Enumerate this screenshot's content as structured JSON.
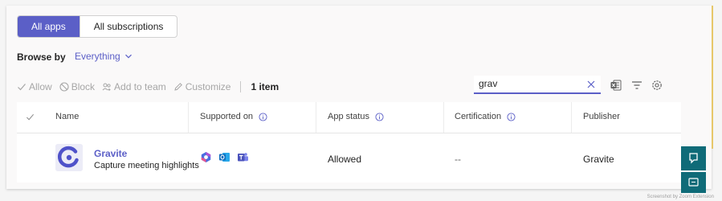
{
  "tabs": [
    {
      "label": "All apps",
      "active": true
    },
    {
      "label": "All subscriptions",
      "active": false
    }
  ],
  "browse": {
    "label": "Browse by",
    "value": "Everything"
  },
  "toolbar": {
    "allow": "Allow",
    "block": "Block",
    "add_to_team": "Add to team",
    "customize": "Customize",
    "item_count": "1 item"
  },
  "search": {
    "value": "grav"
  },
  "table": {
    "columns": [
      "Name",
      "Supported on",
      "App status",
      "Certification",
      "Publisher"
    ],
    "rows": [
      {
        "name": "Gravite",
        "description": "Capture meeting highlights",
        "supported_on": [
          "copilot-icon",
          "outlook-icon",
          "teams-icon"
        ],
        "status": "Allowed",
        "certification": "--",
        "publisher": "Gravite"
      }
    ]
  },
  "watermark": "Screenshot by Zoom Extension",
  "colors": {
    "accent": "#5b5fc7",
    "side_button": "#0f6b78"
  }
}
